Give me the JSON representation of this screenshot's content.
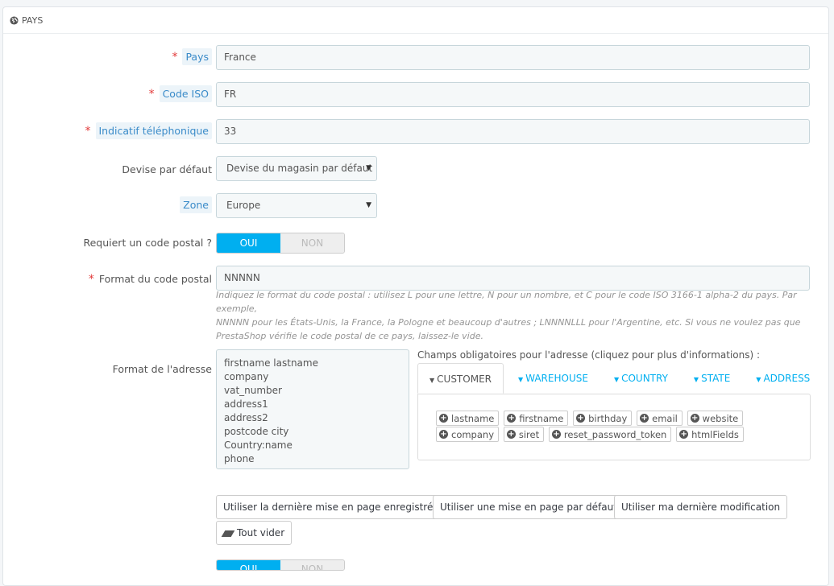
{
  "panel": {
    "title": "PAYS"
  },
  "fields": {
    "country": {
      "label": "Pays",
      "value": "France"
    },
    "iso": {
      "label": "Code ISO",
      "value": "FR"
    },
    "phone": {
      "label": "Indicatif téléphonique",
      "value": "33"
    },
    "currency": {
      "label": "Devise par défaut",
      "value": "Devise du magasin par défaut"
    },
    "zone": {
      "label": "Zone",
      "value": "Europe"
    },
    "need_zip": {
      "label": "Requiert un code postal ?",
      "on": "OUI",
      "off": "NON"
    },
    "zip_format": {
      "label": "Format du code postal",
      "value": "NNNNN",
      "help_line1": "Indiquez le format du code postal : utilisez L pour une lettre, N pour un nombre, et C pour le code ISO 3166-1 alpha-2 du pays. Par exemple,",
      "help_line2": "NNNNN pour les États-Unis, la France, la Pologne et beaucoup d'autres ; LNNNNLLL pour l'Argentine, etc. Si vous ne voulez pas que",
      "help_line3": "PrestaShop vérifie le code postal de ce pays, laissez-le vide."
    },
    "address_format": {
      "label": "Format de l'adresse",
      "lines": [
        "firstname lastname",
        "company",
        "vat_number",
        "address1",
        "address2",
        "postcode city",
        "Country:name",
        "phone"
      ]
    }
  },
  "required_fields": {
    "title": "Champs obligatoires pour l'adresse (cliquez pour plus d'informations) :",
    "tabs": [
      "CUSTOMER",
      "WAREHOUSE",
      "COUNTRY",
      "STATE",
      "ADDRESS"
    ],
    "chips": [
      "lastname",
      "firstname",
      "birthday",
      "email",
      "website",
      "company",
      "siret",
      "reset_password_token",
      "htmlFields"
    ]
  },
  "buttons": {
    "last_saved": "Utiliser la dernière mise en page enregistrée",
    "default_layout": "Utiliser une mise en page par défaut",
    "last_modif": "Utiliser ma dernière modification",
    "clear_all": "Tout vider"
  },
  "next_switch": {
    "on": "OUI",
    "off": "NON"
  }
}
